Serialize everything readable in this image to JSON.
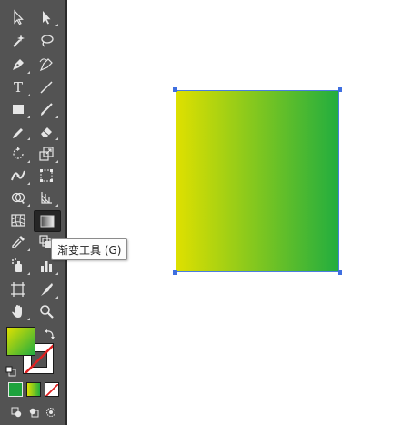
{
  "tooltip": {
    "text": "渐变工具 (G)"
  },
  "colors": {
    "toolbar_bg": "#535353",
    "selection_accent": "#4a7de0",
    "gradient_start": "#dfe000",
    "gradient_end": "#21ad3f",
    "swatch_color": "#1ea33d",
    "swatch_gradient_start": "#dfe000",
    "swatch_gradient_end": "#21ad3f",
    "none_red": "#e02020"
  },
  "tools": [
    {
      "name": "selection-tool",
      "icon": "arrow-outline-icon"
    },
    {
      "name": "direct-selection-tool",
      "icon": "arrow-filled-icon"
    },
    {
      "name": "magic-wand-tool",
      "icon": "magic-wand-icon"
    },
    {
      "name": "lasso-tool",
      "icon": "lasso-icon"
    },
    {
      "name": "pen-tool",
      "icon": "pen-icon"
    },
    {
      "name": "curvature-tool",
      "icon": "curvature-icon"
    },
    {
      "name": "type-tool",
      "icon": "type-icon"
    },
    {
      "name": "line-segment-tool",
      "icon": "line-icon"
    },
    {
      "name": "rectangle-tool",
      "icon": "rectangle-icon"
    },
    {
      "name": "paintbrush-tool",
      "icon": "paintbrush-icon"
    },
    {
      "name": "pencil-tool",
      "icon": "pencil-icon"
    },
    {
      "name": "eraser-tool",
      "icon": "eraser-icon"
    },
    {
      "name": "rotate-tool",
      "icon": "rotate-icon"
    },
    {
      "name": "scale-tool",
      "icon": "scale-icon"
    },
    {
      "name": "width-tool",
      "icon": "width-icon"
    },
    {
      "name": "free-transform-tool",
      "icon": "free-transform-icon"
    },
    {
      "name": "shape-builder-tool",
      "icon": "shape-builder-icon"
    },
    {
      "name": "perspective-grid-tool",
      "icon": "perspective-grid-icon"
    },
    {
      "name": "mesh-tool",
      "icon": "mesh-icon"
    },
    {
      "name": "gradient-tool",
      "icon": "gradient-icon",
      "selected": true
    },
    {
      "name": "eyedropper-tool",
      "icon": "eyedropper-icon"
    },
    {
      "name": "blend-tool",
      "icon": "blend-icon"
    },
    {
      "name": "symbol-sprayer-tool",
      "icon": "symbol-sprayer-icon"
    },
    {
      "name": "column-graph-tool",
      "icon": "column-graph-icon"
    },
    {
      "name": "artboard-tool",
      "icon": "artboard-icon"
    },
    {
      "name": "slice-tool",
      "icon": "slice-icon"
    },
    {
      "name": "hand-tool",
      "icon": "hand-icon"
    },
    {
      "name": "zoom-tool",
      "icon": "zoom-icon"
    }
  ],
  "type_tool_glyph": "T"
}
